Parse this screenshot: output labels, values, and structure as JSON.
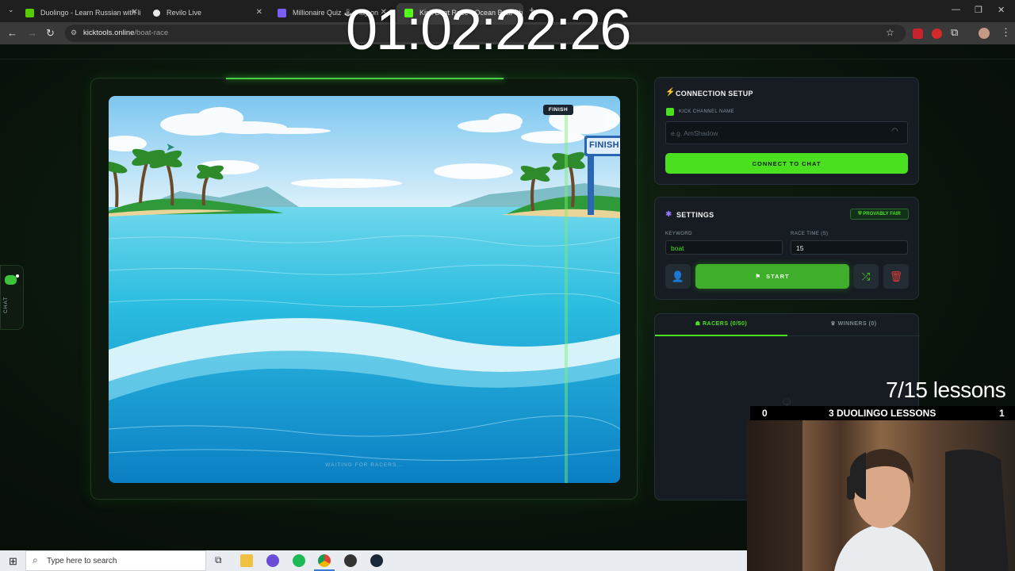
{
  "browser": {
    "tabs": [
      {
        "title": "Duolingo - Learn Russian with li",
        "icon": "duolingo-icon",
        "color": "#58cc02",
        "active": false
      },
      {
        "title": "Revilo Live",
        "icon": "revilo-icon",
        "color": "#e8e8e8",
        "active": false
      },
      {
        "title": "Millionaire Quiz 🕹 Play on",
        "icon": "quiz-icon",
        "color": "#7b5cff",
        "active": false
      },
      {
        "title": "Kick Boat Race - Ocean Boat Sh",
        "icon": "kick-icon",
        "color": "#53fc18",
        "active": true
      }
    ],
    "url_host": "kicktools.online",
    "url_path": "/boat-race",
    "window_controls": {
      "minimize": "—",
      "restore": "❐",
      "close": "✕"
    }
  },
  "game": {
    "finish_badge": "FINISH",
    "finish_sign": "FINISH",
    "waiting_text": "WAITING FOR RACERS..."
  },
  "connection": {
    "title": "CONNECTION SETUP",
    "field_label": "KICK CHANNEL NAME",
    "placeholder": "e.g. AmShadow",
    "connect_label": "CONNECT TO CHAT"
  },
  "settings": {
    "title": "SETTINGS",
    "badge": "PROVABLY FAIR",
    "keyword_label": "KEYWORD",
    "keyword_value": "boat",
    "race_time_label": "RACE TIME (S)",
    "race_time_value": "15",
    "start_label": "START"
  },
  "racers": {
    "tab_racers": "RACERS (0/50)",
    "tab_winners": "WINNERS (0)"
  },
  "sidebar": {
    "chat_label": "CHAT"
  },
  "overlay": {
    "timer": "01:02:22:26",
    "lessons": "7/15 lessons",
    "score_left": "0",
    "score_title": "3 DUOLINGO LESSONS",
    "score_right": "1"
  },
  "taskbar": {
    "search_placeholder": "Type here to search"
  }
}
